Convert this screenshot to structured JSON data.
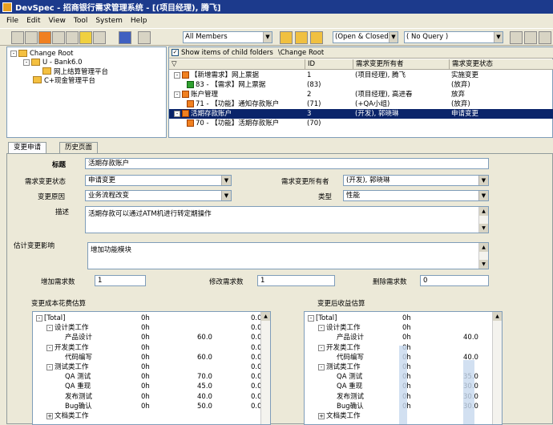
{
  "window": {
    "title": "DevSpec - 招商银行需求管理系统 - [(项目经理), 腾飞]"
  },
  "menu": [
    "File",
    "Edit",
    "View",
    "Tool",
    "System",
    "Help"
  ],
  "toolbar": {
    "members": "All Members",
    "status": "(Open & Closed)",
    "query": "( No Query )"
  },
  "tree": {
    "root": "Change Root",
    "bank": "U - Bank6.0",
    "child1": "网上结算管理平台",
    "child2": "C+现金管理平台"
  },
  "list": {
    "show_child_label": "Show items of child folders",
    "path": "\\Change Root",
    "headers": [
      "ID",
      "需求变更所有者",
      "需求变更状态"
    ],
    "rows": [
      {
        "title": "【新增需求】网上票据",
        "id": "1",
        "owner": "(项目经理), 腾飞",
        "status": "实施变更",
        "level": 0,
        "icon": "o"
      },
      {
        "title": "83 - 【需求】网上票据",
        "id": "(83)",
        "owner": "",
        "status": "(放弃)",
        "level": 1,
        "icon": "g"
      },
      {
        "title": "账户管理",
        "id": "2",
        "owner": "(项目经理), 高进春",
        "status": "放弃",
        "level": 0,
        "icon": "o"
      },
      {
        "title": "71 - 【功能】通知存款账户",
        "id": "(71)",
        "owner": "(+QA小组)",
        "status": "(放弃)",
        "level": 1,
        "icon": "o"
      },
      {
        "title": "活期存款账户",
        "id": "3",
        "owner": "(开发), 郭晓琳",
        "status": "申请变更",
        "level": 0,
        "icon": "o",
        "selected": true
      },
      {
        "title": "70 - 【功能】活期存款账户",
        "id": "(70)",
        "owner": "",
        "status": "",
        "level": 1,
        "icon": "o"
      }
    ]
  },
  "tabs": [
    "变更申请",
    "历史页面"
  ],
  "form": {
    "title_label": "标题",
    "title_value": "活期存款账户",
    "status_label": "需求变更状态",
    "status_value": "申请变更",
    "owner_label": "需求变更所有者",
    "owner_value": "(开发), 郭晓琳",
    "reason_label": "变更原因",
    "reason_value": "业务流程改变",
    "type_label": "类型",
    "type_value": "性能",
    "desc_label": "描述",
    "desc_value": "活期存款可以通过ATM机进行转定期操作",
    "impact_label": "估计变更影响",
    "impact_value": "增加功能模块",
    "add_label": "增加需求数",
    "add_value": "1",
    "mod_label": "修改需求数",
    "mod_value": "1",
    "del_label": "删除需求数",
    "del_value": "0",
    "cost_label": "变更成本花费估算",
    "benefit_label": "变更后收益估算"
  },
  "cost_rows": [
    {
      "name": "[Total]",
      "level": 0,
      "pm": "-",
      "a": "0h",
      "b": "",
      "c": "0.0"
    },
    {
      "name": "设计类工作",
      "level": 1,
      "pm": "-",
      "a": "0h",
      "b": "",
      "c": "0.0"
    },
    {
      "name": "产品设计",
      "level": 2,
      "pm": "",
      "a": "0h",
      "b": "60.0",
      "c": "0.0"
    },
    {
      "name": "开发类工作",
      "level": 1,
      "pm": "-",
      "a": "0h",
      "b": "",
      "c": "0.0"
    },
    {
      "name": "代码编写",
      "level": 2,
      "pm": "",
      "a": "0h",
      "b": "60.0",
      "c": "0.0"
    },
    {
      "name": "测试类工作",
      "level": 1,
      "pm": "-",
      "a": "0h",
      "b": "",
      "c": "0.0"
    },
    {
      "name": "QA 测试",
      "level": 2,
      "pm": "",
      "a": "0h",
      "b": "70.0",
      "c": "0.0"
    },
    {
      "name": "QA 重现",
      "level": 2,
      "pm": "",
      "a": "0h",
      "b": "45.0",
      "c": "0.0"
    },
    {
      "name": "发布测试",
      "level": 2,
      "pm": "",
      "a": "0h",
      "b": "40.0",
      "c": "0.0"
    },
    {
      "name": "Bug确认",
      "level": 2,
      "pm": "",
      "a": "0h",
      "b": "50.0",
      "c": "0.0"
    },
    {
      "name": "文档类工作",
      "level": 1,
      "pm": "+",
      "a": "",
      "b": "",
      "c": ""
    }
  ],
  "benefit_rows": [
    {
      "name": "[Total]",
      "level": 0,
      "pm": "-",
      "a": "0h",
      "b": ""
    },
    {
      "name": "设计类工作",
      "level": 1,
      "pm": "-",
      "a": "0h",
      "b": ""
    },
    {
      "name": "产品设计",
      "level": 2,
      "pm": "",
      "a": "0h",
      "b": "40.0"
    },
    {
      "name": "开发类工作",
      "level": 1,
      "pm": "-",
      "a": "0h",
      "b": ""
    },
    {
      "name": "代码编写",
      "level": 2,
      "pm": "",
      "a": "0h",
      "b": "40.0"
    },
    {
      "name": "测试类工作",
      "level": 1,
      "pm": "-",
      "a": "0h",
      "b": ""
    },
    {
      "name": "QA 测试",
      "level": 2,
      "pm": "",
      "a": "0h",
      "b": "35.0"
    },
    {
      "name": "QA 重现",
      "level": 2,
      "pm": "",
      "a": "0h",
      "b": "30.0"
    },
    {
      "name": "发布测试",
      "level": 2,
      "pm": "",
      "a": "0h",
      "b": "30.0"
    },
    {
      "name": "Bug确认",
      "level": 2,
      "pm": "",
      "a": "0h",
      "b": "30.0"
    },
    {
      "name": "文档类工作",
      "level": 1,
      "pm": "+",
      "a": "",
      "b": ""
    }
  ]
}
